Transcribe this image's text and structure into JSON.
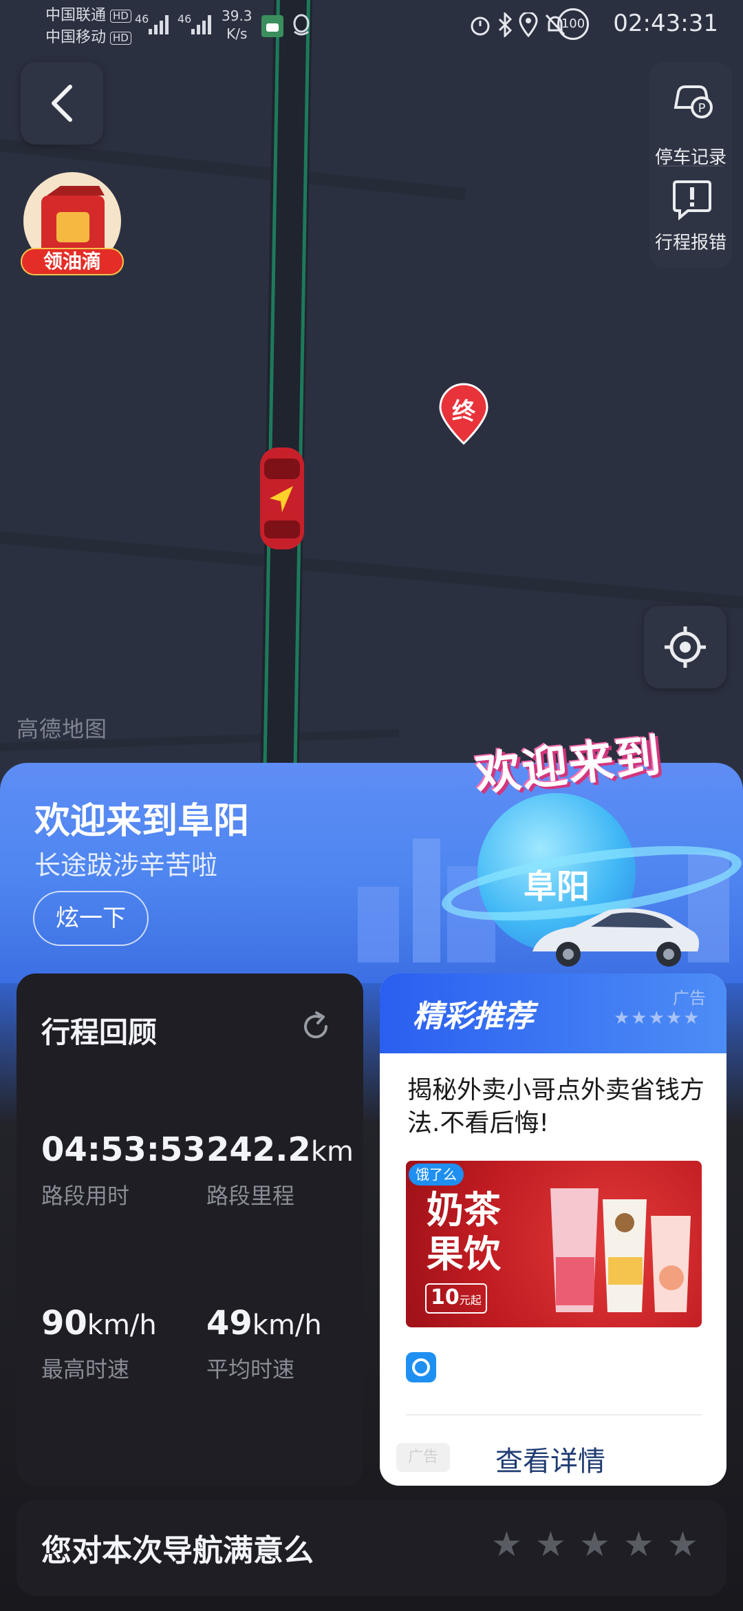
{
  "status_bar": {
    "operator1": "中国联通",
    "operator2": "中国移动",
    "hd": "HD",
    "net1": "46",
    "net2": "46",
    "speed_value": "39.3",
    "speed_unit": "K/s",
    "battery": "100",
    "time": "02:43:31"
  },
  "map": {
    "oil_promo_label": "领油滴",
    "destination_marker": "终",
    "watermark": "高德地图",
    "side_actions": [
      {
        "label": "停车记录"
      },
      {
        "label": "行程报错"
      }
    ]
  },
  "banner": {
    "title": "欢迎来到阜阳",
    "subtitle": "长途跋涉辛苦啦",
    "button_label": "炫一下",
    "graphic_title": "欢迎来到",
    "graphic_city": "阜阳"
  },
  "trip": {
    "title": "行程回顾",
    "stats": [
      {
        "value": "04:53:53",
        "unit": "",
        "label": "路段用时"
      },
      {
        "value": "242.2",
        "unit": "km",
        "label": "路段里程"
      },
      {
        "value": "90",
        "unit": "km/h",
        "label": "最高时速"
      },
      {
        "value": "49",
        "unit": "km/h",
        "label": "平均时速"
      }
    ]
  },
  "ad": {
    "header_title": "精彩推荐",
    "ad_tag": "广告",
    "headline": "揭秘外卖小哥点外卖省钱方法.不看后悔!",
    "brand": "饿了么",
    "image_text_line1": "奶茶",
    "image_text_line2": "果饮",
    "image_badge_num": "10",
    "image_badge_text": "元起",
    "footer_tag": "广告",
    "details_button": "查看详情"
  },
  "rating": {
    "question": "您对本次导航满意么",
    "stars": 5
  },
  "colors": {
    "accent_blue": "#3f78ee",
    "map_bg": "#2b3040",
    "route_green": "#1d7a5a",
    "marker_red": "#e8333a"
  }
}
